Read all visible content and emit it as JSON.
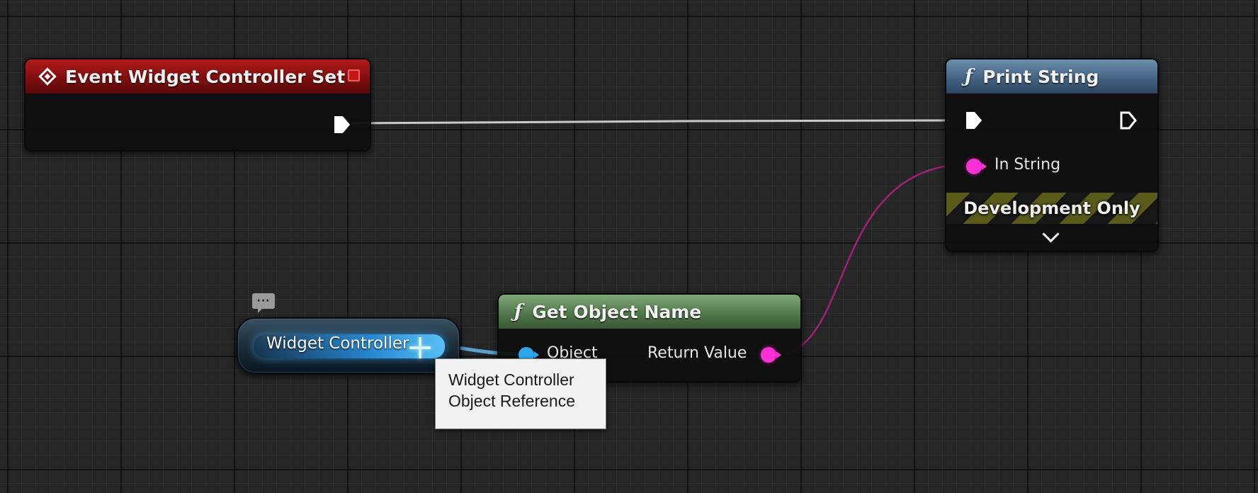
{
  "graph": {
    "nodes": {
      "event_widget_controller_set": {
        "title": "Event Widget Controller Set",
        "icon": "event-diamond-icon",
        "header_color": "#8a1010"
      },
      "print_string": {
        "title": "Print String",
        "icon": "function-f-icon",
        "header_color": "#4a6a88",
        "pins": {
          "in_string": "In String"
        },
        "development_only": "Development Only"
      },
      "get_object_name": {
        "title": "Get Object Name",
        "icon": "function-f-icon",
        "header_color": "#577f50",
        "pins": {
          "object": "Object",
          "return_value": "Return Value"
        }
      },
      "widget_controller_var": {
        "label": "Widget Controller",
        "comment_icon": "comment-bubble-icon"
      }
    },
    "tooltip": {
      "line1": "Widget Controller",
      "line2": "Object Reference"
    },
    "colors": {
      "exec_pin": "#ffffff",
      "string_pin": "#ff2fd6",
      "object_pin": "#2fa6f0",
      "string_wire": "#a0207a",
      "exec_wire": "#c8c8c8"
    }
  }
}
